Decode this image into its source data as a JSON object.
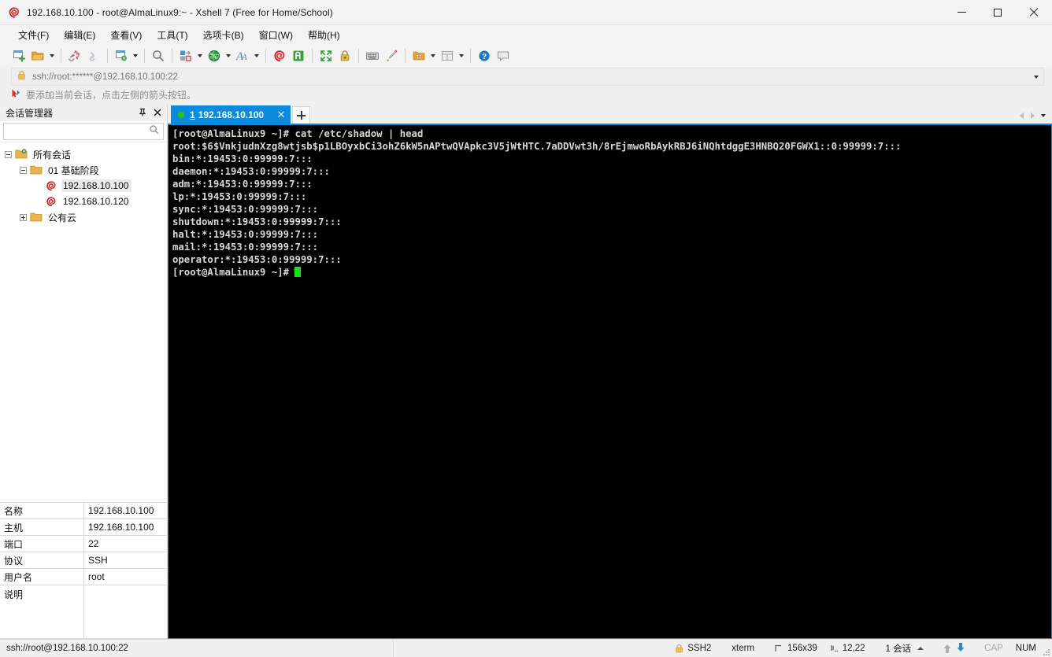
{
  "window": {
    "title": "192.168.10.100 - root@AlmaLinux9:~ - Xshell 7 (Free for Home/School)",
    "app_icon": "xshell-spiral-icon",
    "minimize_label": "Minimize",
    "maximize_label": "Maximize",
    "close_label": "Close"
  },
  "menubar": {
    "items": [
      {
        "label": "文件(F)",
        "name": "menu-file"
      },
      {
        "label": "编辑(E)",
        "name": "menu-edit"
      },
      {
        "label": "查看(V)",
        "name": "menu-view"
      },
      {
        "label": "工具(T)",
        "name": "menu-tools"
      },
      {
        "label": "选项卡(B)",
        "name": "menu-tabs"
      },
      {
        "label": "窗口(W)",
        "name": "menu-window"
      },
      {
        "label": "帮助(H)",
        "name": "menu-help"
      }
    ]
  },
  "toolbar": {
    "buttons": [
      {
        "name": "new-session-icon",
        "tip": "新建会话"
      },
      {
        "name": "open-session-icon",
        "tip": "打开会话"
      },
      {
        "name": "disconnect-icon",
        "tip": "断开连接"
      },
      {
        "name": "reconnect-icon",
        "tip": "重新连接"
      },
      {
        "name": "session-properties-icon",
        "tip": "属性"
      },
      {
        "name": "find-icon",
        "tip": "查找"
      },
      {
        "name": "layout-icon",
        "tip": "布局"
      },
      {
        "name": "globe-icon",
        "tip": "编码"
      },
      {
        "name": "font-icon",
        "tip": "字体"
      },
      {
        "name": "xshell-icon",
        "tip": "Xshell"
      },
      {
        "name": "xftp-icon",
        "tip": "新建文件传输"
      },
      {
        "name": "fullscreen-icon",
        "tip": "全屏"
      },
      {
        "name": "lock-icon",
        "tip": "锁定"
      },
      {
        "name": "keyboard-icon",
        "tip": "发送键输入到所有会话"
      },
      {
        "name": "highlight-pen-icon",
        "tip": "高亮"
      },
      {
        "name": "add-folder-icon",
        "tip": "新建文件夹"
      },
      {
        "name": "split-view-icon",
        "tip": "排列"
      },
      {
        "name": "help-icon",
        "tip": "帮助"
      },
      {
        "name": "comment-icon",
        "tip": "反馈"
      }
    ]
  },
  "address_bar": {
    "icon": "lock-icon",
    "value": "ssh://root:******@192.168.10.100:22",
    "placeholder": "ssh://root:******@192.168.10.100:22",
    "dropdown_icon": "chevron-down-icon"
  },
  "notice_bar": {
    "icon": "red-arrow-icon",
    "text": "要添加当前会话，点击左侧的箭头按钮。"
  },
  "sidebar": {
    "title": "会话管理器",
    "pin_icon": "pin-icon",
    "close_icon": "close-icon",
    "search": {
      "value": "",
      "placeholder": "",
      "icon": "search-icon"
    },
    "tree": [
      {
        "label": "所有会话",
        "icon": "folder-gear-icon",
        "depth": 0,
        "expander": "minus",
        "selected": false
      },
      {
        "label": "01 基础阶段",
        "icon": "folder-icon",
        "depth": 1,
        "expander": "minus",
        "selected": false
      },
      {
        "label": "192.168.10.100",
        "icon": "xshell-session-icon",
        "depth": 2,
        "expander": "none",
        "selected": true
      },
      {
        "label": "192.168.10.120",
        "icon": "xshell-session-icon",
        "depth": 2,
        "expander": "none",
        "selected": false
      },
      {
        "label": "公有云",
        "icon": "folder-icon",
        "depth": 1,
        "expander": "plus",
        "selected": false
      }
    ],
    "properties": [
      {
        "key": "名称",
        "value": "192.168.10.100"
      },
      {
        "key": "主机",
        "value": "192.168.10.100"
      },
      {
        "key": "端口",
        "value": "22"
      },
      {
        "key": "协议",
        "value": "SSH"
      },
      {
        "key": "用户名",
        "value": "root"
      },
      {
        "key": "说明",
        "value": ""
      }
    ]
  },
  "tabs": {
    "items": [
      {
        "number": "1",
        "label": "192.168.10.100",
        "status": "connected",
        "active": true,
        "close_icon": "close-icon"
      }
    ],
    "new_tab_icon": "plus-icon",
    "prev_icon": "chevron-left-icon",
    "next_icon": "chevron-right-icon",
    "list_icon": "chevron-down-icon"
  },
  "terminal": {
    "lines": [
      "[root@AlmaLinux9 ~]# cat /etc/shadow | head",
      "root:$6$VnkjudnXzg8wtjsb$p1LBOyxbCi3ohZ6kW5nAPtwQVApkc3V5jWtHTC.7aDDVwt3h/8rEjmwoRbAykRBJ6iNQhtdggE3HNBQ20FGWX1::0:99999:7:::",
      "bin:*:19453:0:99999:7:::",
      "daemon:*:19453:0:99999:7:::",
      "adm:*:19453:0:99999:7:::",
      "lp:*:19453:0:99999:7:::",
      "sync:*:19453:0:99999:7:::",
      "shutdown:*:19453:0:99999:7:::",
      "halt:*:19453:0:99999:7:::",
      "mail:*:19453:0:99999:7:::",
      "operator:*:19453:0:99999:7:::"
    ],
    "prompt": "[root@AlmaLinux9 ~]# ",
    "bg_color": "#000000",
    "fg_color": "#d8d8d8",
    "cursor_color": "#18e018"
  },
  "statusbar": {
    "connection": "ssh://root@192.168.10.100:22",
    "protocol": "SSH2",
    "protocol_icon": "lock-icon",
    "terminal_type": "xterm",
    "size_icon": "screen-size-icon",
    "size": "156x39",
    "cursor_icon": "cursor-pos-icon",
    "cursor_pos": "12,22",
    "sessions": "1 会话",
    "sessions_caret": "caret-up-icon",
    "upload_icon": "arrow-up-icon",
    "download_icon": "arrow-down-icon",
    "caps": "CAP",
    "num": "NUM",
    "grip": "resize-grip-icon"
  }
}
